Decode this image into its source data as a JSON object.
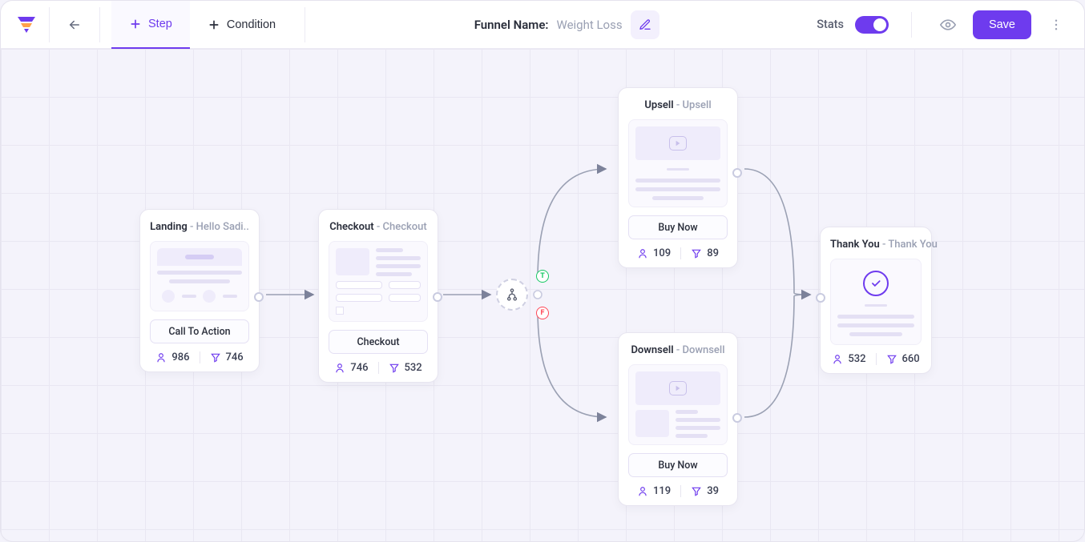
{
  "header": {
    "step_label": "Step",
    "condition_label": "Condition",
    "funnel_name_label": "Funnel Name:",
    "funnel_name_value": "Weight Loss",
    "stats_label": "Stats",
    "save_label": "Save"
  },
  "nodes": {
    "landing": {
      "type": "Landing",
      "subtitle": "Hello Sadi..",
      "cta": "Call To Action",
      "visitors": "986",
      "conversions": "746"
    },
    "checkout": {
      "type": "Checkout",
      "subtitle": "Checkout",
      "cta": "Checkout",
      "visitors": "746",
      "conversions": "532"
    },
    "upsell": {
      "type": "Upsell",
      "subtitle": "Upsell",
      "cta": "Buy Now",
      "visitors": "109",
      "conversions": "89"
    },
    "downsell": {
      "type": "Downsell",
      "subtitle": "Downsell",
      "cta": "Buy Now",
      "visitors": "119",
      "conversions": "39"
    },
    "thankyou": {
      "type": "Thank You",
      "subtitle": "Thank You",
      "visitors": "532",
      "conversions": "660"
    }
  },
  "condition": {
    "t": "T",
    "f": "F"
  }
}
